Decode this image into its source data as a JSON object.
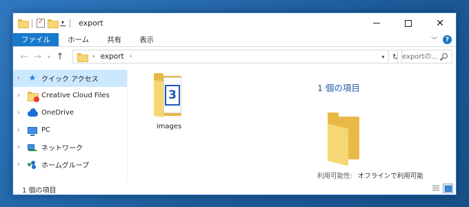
{
  "window": {
    "title": "export"
  },
  "ribbon": {
    "tabs": [
      {
        "label": "ファイル"
      },
      {
        "label": "ホーム"
      },
      {
        "label": "共有"
      },
      {
        "label": "表示"
      }
    ]
  },
  "address": {
    "path": [
      "export"
    ],
    "search_placeholder": "exportの..."
  },
  "navpane": {
    "items": [
      {
        "label": "クイック アクセス",
        "icon": "star-icon",
        "selected": true
      },
      {
        "label": "Creative Cloud Files",
        "icon": "creative-cloud-folder-icon"
      },
      {
        "label": "OneDrive",
        "icon": "cloud-icon"
      },
      {
        "label": "PC",
        "icon": "computer-icon"
      },
      {
        "label": "ネットワーク",
        "icon": "network-icon"
      },
      {
        "label": "ホームグループ",
        "icon": "homegroup-icon"
      }
    ]
  },
  "content": {
    "items": [
      {
        "label": "images",
        "type": "folder"
      }
    ]
  },
  "details": {
    "title": "1 個の項目",
    "availability_label": "利用可能性:",
    "availability_value": "オフラインで利用可能"
  },
  "statusbar": {
    "text": "1 個の項目"
  },
  "colors": {
    "accent": "#1979ca",
    "selection": "#cce8ff",
    "details_title": "#1e5aa6"
  }
}
